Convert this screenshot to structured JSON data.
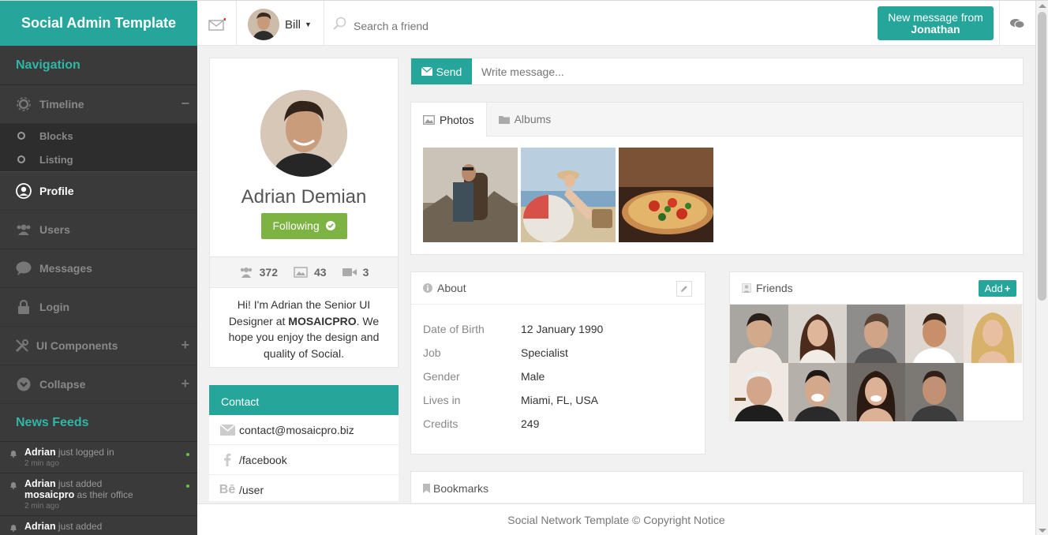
{
  "brand": "Social Admin Template",
  "sidebar": {
    "nav_title": "Navigation",
    "items": [
      {
        "label": "Timeline",
        "icon": "gear-icon"
      },
      {
        "label": "Blocks"
      },
      {
        "label": "Listing"
      },
      {
        "label": "Profile",
        "icon": "user-circle-icon"
      },
      {
        "label": "Users",
        "icon": "users-icon"
      },
      {
        "label": "Messages",
        "icon": "chat-icon"
      },
      {
        "label": "Login",
        "icon": "lock-icon"
      },
      {
        "label": "UI Components",
        "icon": "tools-icon"
      },
      {
        "label": "Collapse",
        "icon": "chevron-circle-icon"
      }
    ],
    "feeds_title": "News Feeds",
    "feeds": [
      {
        "user": "Adrian",
        "action": " just logged in",
        "time": "2 min ago"
      },
      {
        "user": "Adrian",
        "action": " just added",
        "object": "mosaicpro",
        "action2": " as their office",
        "time": "2 min ago"
      },
      {
        "user": "Adrian",
        "action": " just added",
        "time": ""
      }
    ]
  },
  "topbar": {
    "user_name": "Bill",
    "search_placeholder": "Search a friend",
    "new_message_line1": "New message from",
    "new_message_line2": "Jonathan"
  },
  "profile": {
    "name": "Adrian Demian",
    "follow_label": "Following",
    "stats": {
      "friends": "372",
      "photos": "43",
      "videos": "3"
    },
    "bio_pre": "Hi! I'm Adrian the Senior UI Designer at ",
    "bio_company": "MOSAICPRO",
    "bio_post": ". We hope you enjoy the design and quality of Social."
  },
  "contact": {
    "title": "Contact",
    "email": "contact@mosaicpro.biz",
    "facebook": "/facebook",
    "behance": "/user"
  },
  "composer": {
    "send_label": "Send",
    "placeholder": "Write message..."
  },
  "media": {
    "tabs": [
      "Photos",
      "Albums"
    ]
  },
  "about": {
    "title": "About",
    "rows": [
      {
        "key": "Date of Birth",
        "value": "12 January 1990"
      },
      {
        "key": "Job",
        "value": "Specialist"
      },
      {
        "key": "Gender",
        "value": "Male"
      },
      {
        "key": "Lives in",
        "value": "Miami, FL, USA"
      },
      {
        "key": "Credits",
        "value": "249"
      }
    ]
  },
  "friends": {
    "title": "Friends",
    "add_label": "Add"
  },
  "bookmarks": {
    "title": "Bookmarks"
  },
  "footer": "Social Network Template © Copyright Notice",
  "colors": {
    "accent": "#26a69a",
    "follow_green": "#7cb342",
    "sidebar_bg": "#3a3a3a"
  }
}
